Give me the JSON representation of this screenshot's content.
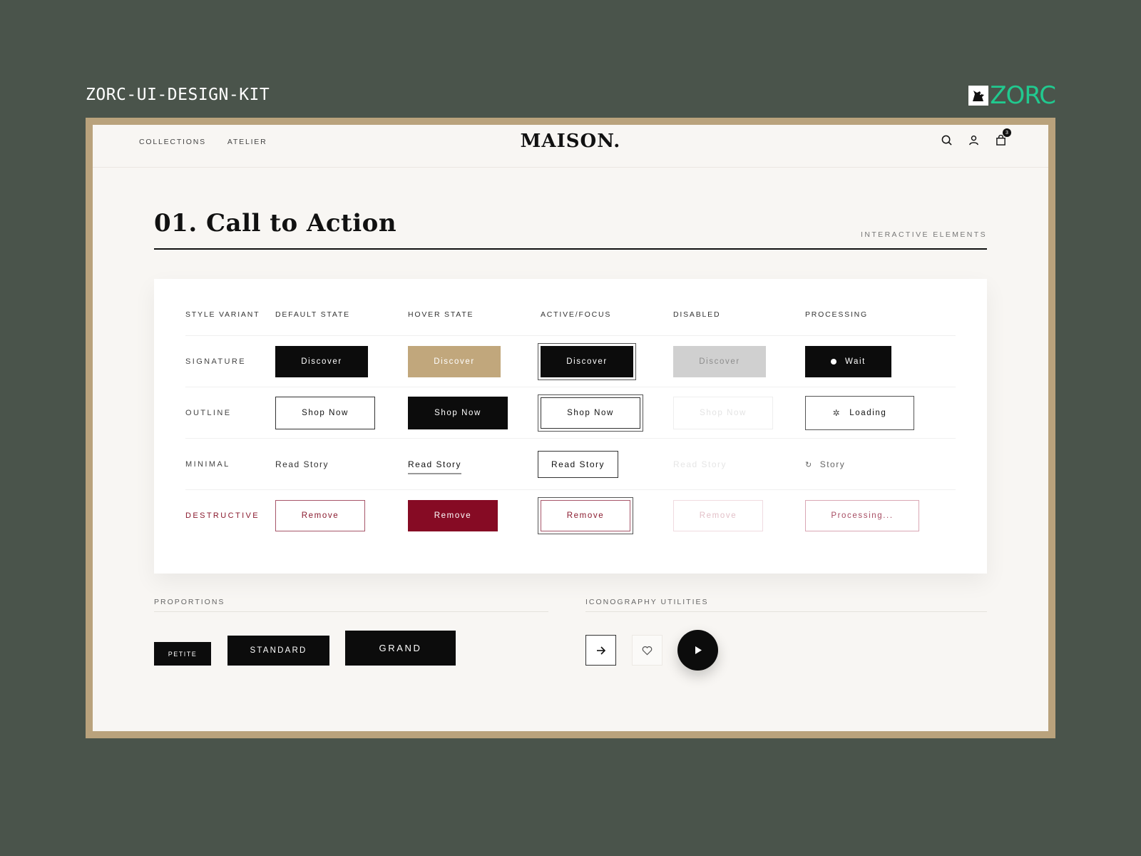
{
  "kit_title": "ZORC-UI-DESIGN-KIT",
  "brand": {
    "name": "ZORC",
    "logo_icon": "wolf-logo-icon",
    "color": "#21c98f"
  },
  "nav": {
    "links": [
      "COLLECTIONS",
      "ATELIER"
    ],
    "logo": "MAISON.",
    "icons": [
      "search-icon",
      "user-icon",
      "bag-icon"
    ],
    "cart_count": "3"
  },
  "section": {
    "title": "01. Call to Action",
    "subtitle": "INTERACTIVE ELEMENTS"
  },
  "table": {
    "headers": [
      "STYLE VARIANT",
      "DEFAULT STATE",
      "HOVER STATE",
      "ACTIVE/FOCUS",
      "DISABLED",
      "PROCESSING"
    ],
    "rows": [
      {
        "label": "SIGNATURE",
        "default": "Discover",
        "hover": "Discover",
        "active": "Discover",
        "disabled": "Discover",
        "processing": "Wait"
      },
      {
        "label": "OUTLINE",
        "default": "Shop Now",
        "hover": "Shop Now",
        "active": "Shop Now",
        "disabled": "Shop Now",
        "processing": "Loading"
      },
      {
        "label": "MINIMAL",
        "default": "Read Story",
        "hover": "Read Story",
        "active": "Read Story",
        "disabled": "Read Story",
        "processing": "Story"
      },
      {
        "label": "DESTRUCTIVE",
        "default": "Remove",
        "hover": "Remove",
        "active": "Remove",
        "disabled": "Remove",
        "processing": "Processing..."
      }
    ]
  },
  "proportions": {
    "title": "PROPORTIONS",
    "buttons": [
      "PETITE",
      "STANDARD",
      "GRAND"
    ]
  },
  "iconography": {
    "title": "ICONOGRAPHY UTILITIES",
    "icons": [
      "arrow-right-icon",
      "heart-icon",
      "play-icon"
    ]
  },
  "colors": {
    "accent_gold": "#c1a77c",
    "destructive": "#860b24",
    "frame": "#b9a27c",
    "background": "#4a544b"
  }
}
